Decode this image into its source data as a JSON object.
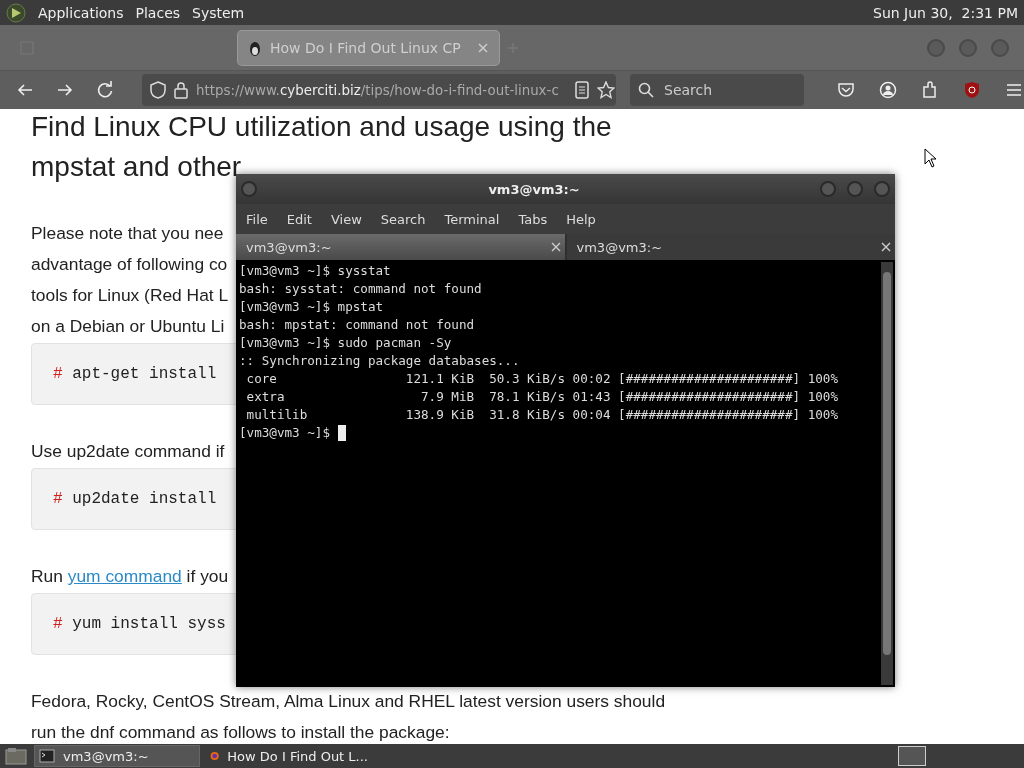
{
  "top_panel": {
    "menus": [
      "Applications",
      "Places",
      "System"
    ],
    "clock": "Sun Jun 30,  2:31 PM"
  },
  "browser": {
    "tabs": [
      {
        "kind": "faded",
        "selected": false
      },
      {
        "kind": "page",
        "title": "How Do I Find Out Linux CP",
        "selected": true
      }
    ],
    "address": {
      "scheme": "https://www.",
      "host": "cyberciti.biz",
      "path": "/tips/how-do-i-find-out-linux-c"
    },
    "search": {
      "placeholder": "Search"
    }
  },
  "page": {
    "heading_lines": [
      "Find Linux CPU utilization and usage using the",
      "mpstat and other"
    ],
    "blocks": [
      {
        "kind": "para",
        "lines": [
          [
            {
              "text": "Please note that you nee"
            }
          ],
          [
            {
              "text": "advantage of following co"
            }
          ],
          [
            {
              "text": "tools for Linux (Red Hat L"
            }
          ],
          [
            {
              "text": "on a Debian or Ubuntu Li"
            }
          ]
        ]
      },
      {
        "kind": "code",
        "prompt": "#",
        "command": "apt-get install"
      },
      {
        "kind": "para",
        "lines": [
          [
            {
              "text": "Use up2date command if"
            }
          ]
        ]
      },
      {
        "kind": "code",
        "prompt": "#",
        "command": "up2date install"
      },
      {
        "kind": "para",
        "lines": [
          [
            {
              "text": "Run "
            },
            {
              "text": "yum command",
              "kind": "link"
            },
            {
              "text": " if you"
            }
          ]
        ]
      },
      {
        "kind": "code",
        "prompt": "#",
        "command": "yum install syss"
      },
      {
        "kind": "para",
        "lines": [
          [
            {
              "text": "Fedora, Rocky, CentOS Stream, Alma Linux and RHEL latest version users should"
            }
          ],
          [
            {
              "text": "run the dnf command as follows to install the package:"
            }
          ]
        ]
      }
    ]
  },
  "terminal": {
    "title": "vm3@vm3:~",
    "menus": [
      "File",
      "Edit",
      "View",
      "Search",
      "Terminal",
      "Tabs",
      "Help"
    ],
    "tabs": [
      {
        "title": "vm3@vm3:~",
        "selected": true
      },
      {
        "title": "vm3@vm3:~",
        "selected": false
      }
    ],
    "lines": [
      "[vm3@vm3 ~]$ sysstat",
      "bash: sysstat: command not found",
      "[vm3@vm3 ~]$ mpstat",
      "bash: mpstat: command not found",
      "[vm3@vm3 ~]$ sudo pacman -Sy",
      ":: Synchronizing package databases...",
      " core                 121.1 KiB  50.3 KiB/s 00:02 [######################] 100%",
      " extra                  7.9 MiB  78.1 KiB/s 01:43 [######################] 100%",
      " multilib             138.9 KiB  31.8 KiB/s 00:04 [######################] 100%",
      "[vm3@vm3 ~]$ "
    ]
  },
  "taskbar": {
    "items": [
      {
        "kind": "terminal",
        "label": "vm3@vm3:~",
        "selected": true
      },
      {
        "kind": "browser",
        "label": "How Do I Find Out L...",
        "selected": false
      }
    ]
  }
}
